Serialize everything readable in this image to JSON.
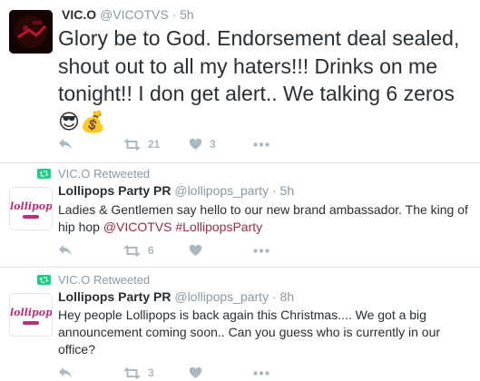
{
  "tweets": [
    {
      "retweet_context": "",
      "display_name": "VIC.O",
      "handle": "@VICOTVS",
      "separator": "·",
      "time": "5h",
      "text": "Glory be to God. Endorsement deal sealed, shout out to all my haters!!! Drinks on me tonight!! I don get alert.. We talking 6 zeros",
      "emoji": "😎💰",
      "retweets": "21",
      "likes": "3"
    },
    {
      "retweet_context": "VIC.O Retweeted",
      "display_name": "Lollipops Party PR",
      "handle": "@lollipops_party",
      "separator": "·",
      "time": "5h",
      "text": "Ladies & Gentlemen say hello to our new brand ambassador. The king of hip hop",
      "mention": "@VICOTVS",
      "hashtag": "#LollipopsParty",
      "retweets": "6",
      "likes": ""
    },
    {
      "retweet_context": "VIC.O Retweeted",
      "display_name": "Lollipops Party PR",
      "handle": "@lollipops_party",
      "separator": "·",
      "time": "8h",
      "text": "Hey people Lollipops is back again this Christmas.... We got a big announcement coming soon.. Can you guess who is currently in our office?",
      "retweets": "3",
      "likes": ""
    }
  ],
  "avatar_text": "lollipops",
  "colors": {
    "link": "#9b2c3e",
    "muted": "#8899a6",
    "icon": "#aab8c2",
    "retweet_green": "#19cf86",
    "border": "#e1e8ed"
  },
  "icons": [
    "reply-icon",
    "retweet-icon",
    "heart-icon",
    "more-icon"
  ]
}
